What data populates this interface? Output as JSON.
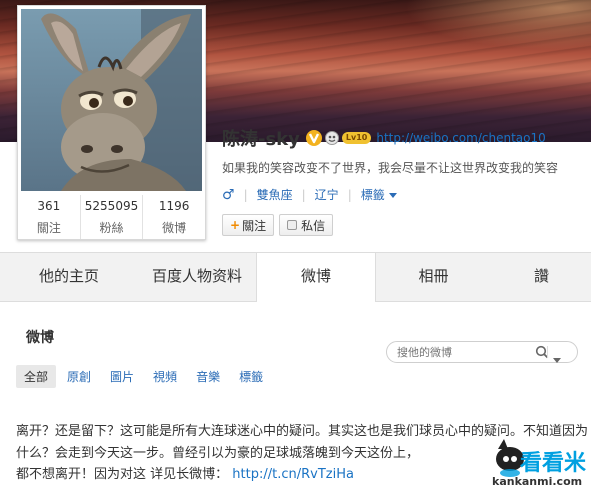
{
  "profile": {
    "name": "陈涛-sky",
    "level": "Lv10",
    "url": "http://weibo.com/chentao10",
    "bio": "如果我的笑容改变不了世界，我会尽量不让这世界改变我的笑容",
    "gender_symbol": "♂",
    "zodiac": "雙魚座",
    "location": "辽宁",
    "tags_label": "標籤",
    "follow_label": "關注",
    "message_label": "私信"
  },
  "stats": [
    {
      "num": "361",
      "label": "關注"
    },
    {
      "num": "5255095",
      "label": "粉絲"
    },
    {
      "num": "1196",
      "label": "微博"
    }
  ],
  "tabs": [
    {
      "label": "他的主页"
    },
    {
      "label": "百度人物资料"
    },
    {
      "label": "微博"
    },
    {
      "label": "相冊"
    },
    {
      "label": "讚"
    }
  ],
  "weibo": {
    "section_title": "微博",
    "search_placeholder": "搜他的微博",
    "filters": [
      "全部",
      "原創",
      "圖片",
      "視頻",
      "音樂",
      "標籤"
    ]
  },
  "post": {
    "text": "离开？还是留下？这可能是所有大连球迷心中的疑问。其实这也是我们球员心中的疑问。不知道因为什么？会走到今天这一步。曾经引以为豪的足球城落魄到今天这份上，",
    "text2": "都不想离开！因为对这 详见长微博：",
    "link": "http://t.cn/RvTziHa"
  },
  "watermark": {
    "brand": "看看米",
    "domain": "kankanmi.com"
  },
  "colors": {
    "link": "#1a73c4",
    "accent_orange": "#f08a00",
    "watermark_blue": "#00a0e0"
  }
}
